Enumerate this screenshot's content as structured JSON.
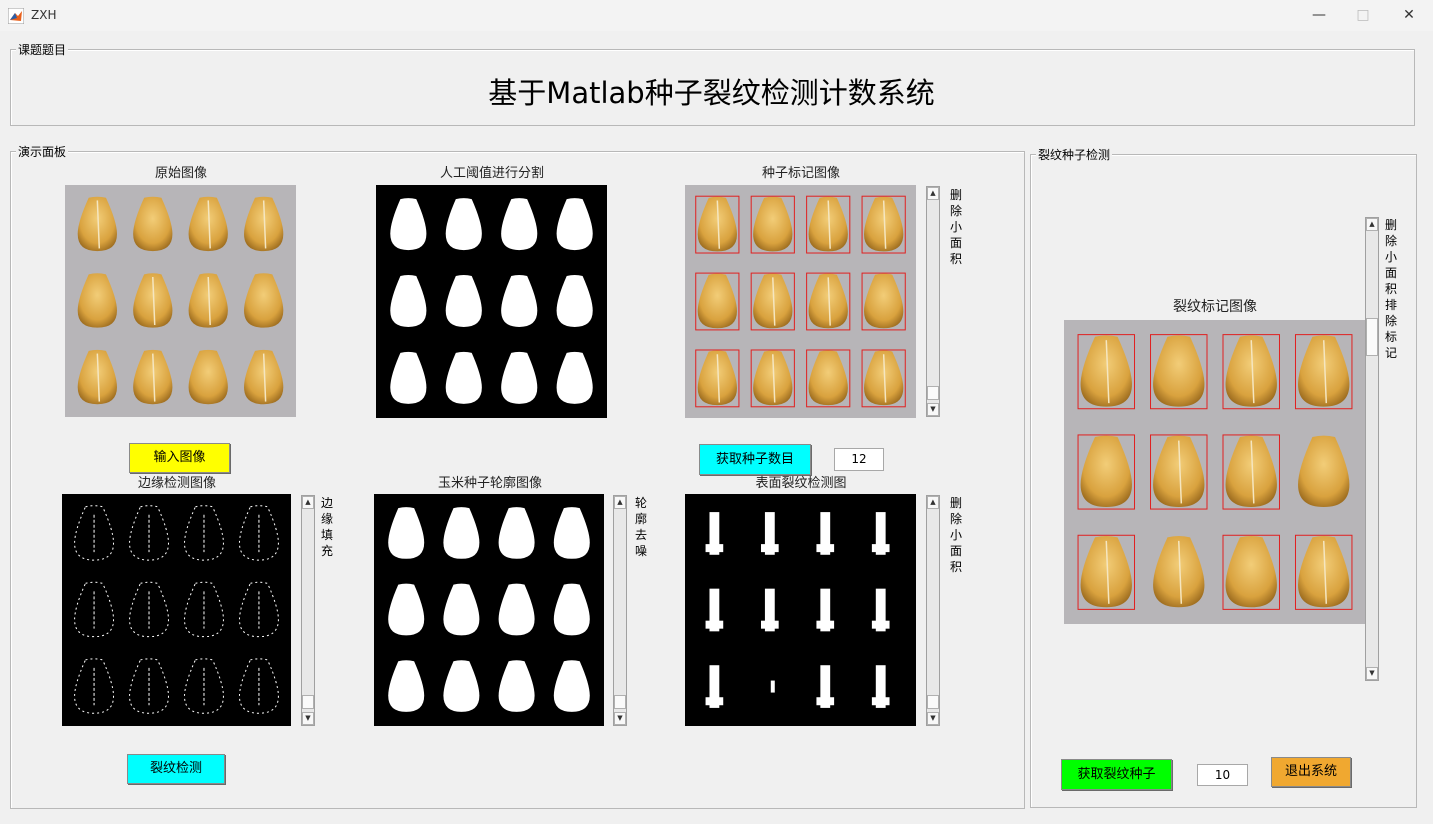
{
  "window": {
    "title": "ZXH"
  },
  "header_panel": {
    "label": "课题题目",
    "title": "基于Matlab种子裂纹检测计数系统"
  },
  "demo_panel": {
    "label": "演示面板",
    "images": {
      "original": "原始图像",
      "threshold": "人工阈值进行分割",
      "marked": "种子标记图像",
      "edge": "边缘检测图像",
      "contour": "玉米种子轮廓图像",
      "crack": "表面裂纹检测图"
    },
    "slider_labels": {
      "marked": "删除小面积",
      "edge": "边缘填充",
      "contour": "轮廓去噪",
      "crack": "删除小面积"
    },
    "buttons": {
      "input_image": "输入图像",
      "get_seed_count": "获取种子数目",
      "crack_detect": "裂纹检测"
    },
    "seed_count": "12"
  },
  "crack_panel": {
    "label": "裂纹种子检测",
    "image_title": "裂纹标记图像",
    "slider_label": "删除小面积排除标记",
    "buttons": {
      "get_crack_seeds": "获取裂纹种子",
      "exit": "退出系统"
    },
    "crack_count": "10"
  },
  "colors": {
    "input_button": "#ffff00",
    "seed_button": "#00ffff",
    "crack_button": "#00ffff",
    "crack_seed_button": "#00ff00",
    "exit_button": "#f0a830",
    "marker": "#e02020"
  }
}
